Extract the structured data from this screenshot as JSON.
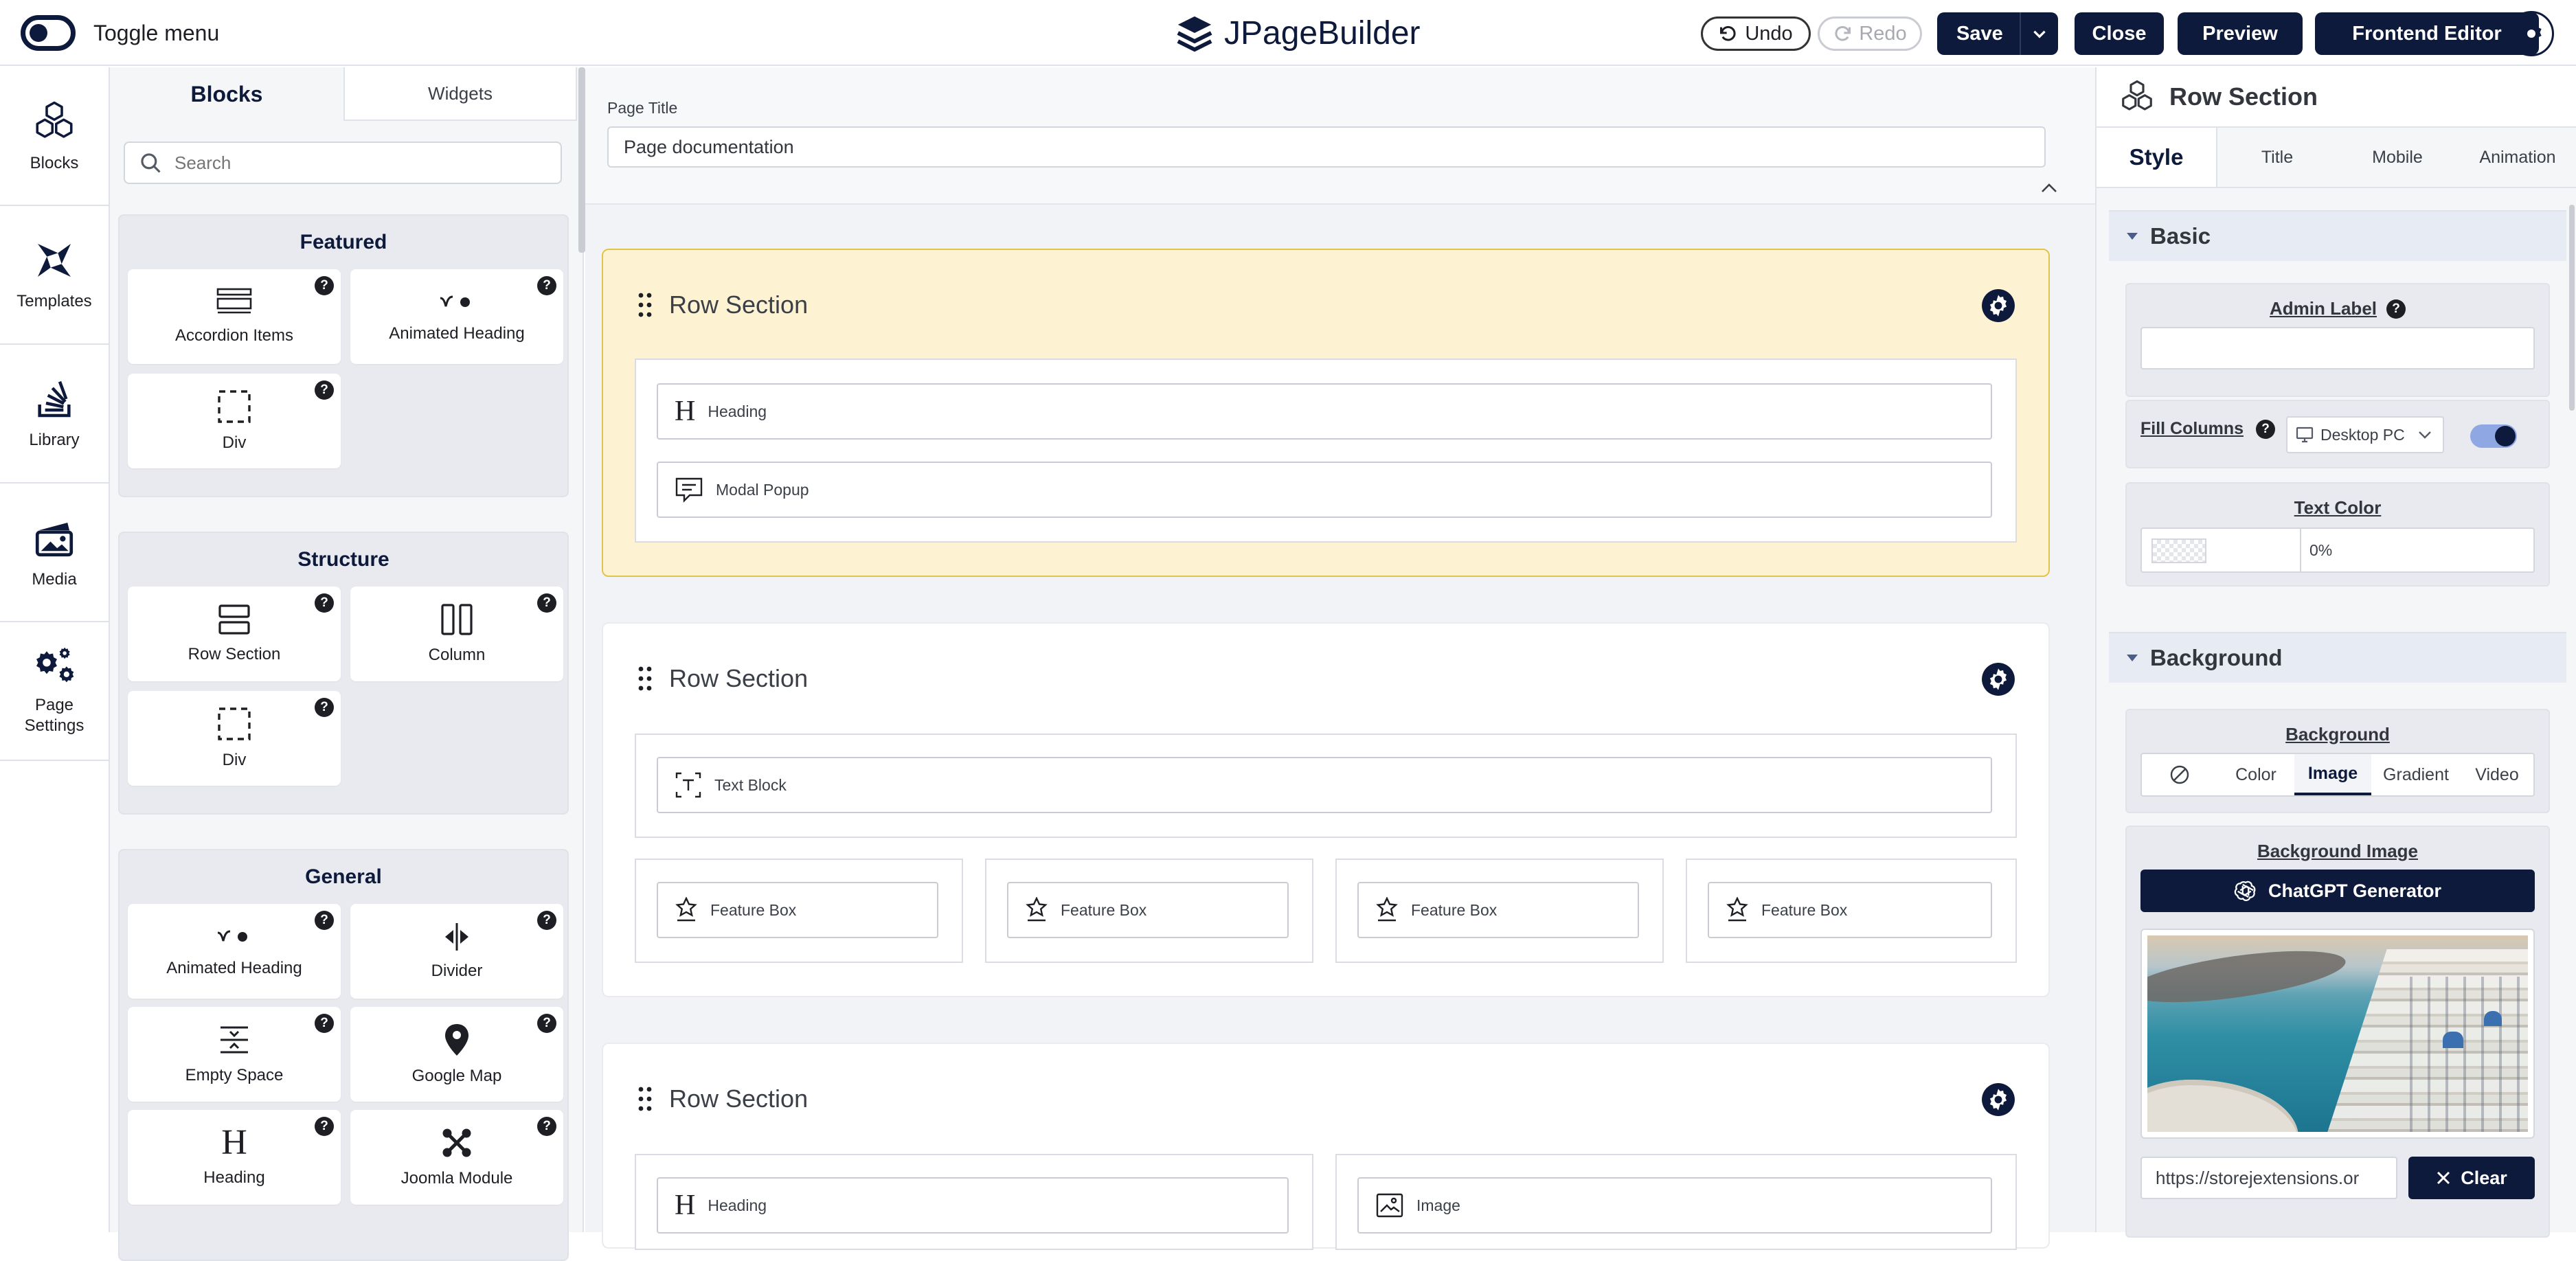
{
  "topbar": {
    "toggle_label": "Toggle menu",
    "brand": "JPageBuilder",
    "undo": "Undo",
    "redo": "Redo",
    "save": "Save",
    "close": "Close",
    "preview": "Preview",
    "frontend_editor": "Frontend Editor"
  },
  "rail": {
    "items": [
      {
        "label": "Blocks",
        "icon": "cubes-icon"
      },
      {
        "label": "Templates",
        "icon": "templates-icon"
      },
      {
        "label": "Library",
        "icon": "library-icon"
      },
      {
        "label": "Media",
        "icon": "media-icon"
      },
      {
        "label": "Page Settings",
        "icon": "gears-icon"
      }
    ]
  },
  "blocks_panel": {
    "tabs": [
      "Blocks",
      "Widgets"
    ],
    "search_placeholder": "Search",
    "groups": [
      {
        "title": "Featured",
        "items": [
          "Accordion Items",
          "Animated Heading",
          "Div"
        ]
      },
      {
        "title": "Structure",
        "items": [
          "Row Section",
          "Column",
          "Div"
        ]
      },
      {
        "title": "General",
        "items": [
          "Animated Heading",
          "Divider",
          "Empty Space",
          "Google Map",
          "Heading",
          "Joomla Module"
        ]
      }
    ]
  },
  "canvas": {
    "page_title_label": "Page Title",
    "page_title_value": "Page documentation",
    "sections": [
      {
        "title": "Row Section",
        "addons": [
          "Heading",
          "Modal Popup"
        ]
      },
      {
        "title": "Row Section",
        "addons": [
          "Text Block",
          "Feature Box",
          "Feature Box",
          "Feature Box",
          "Feature Box"
        ]
      },
      {
        "title": "Row Section",
        "addons": [
          "Heading",
          "Image"
        ]
      }
    ]
  },
  "right_panel": {
    "title": "Row Section",
    "tabs": [
      "Style",
      "Title",
      "Mobile",
      "Animation"
    ],
    "basic": {
      "header": "Basic",
      "admin_label": "Admin Label",
      "admin_label_value": "",
      "fill_columns": "Fill Columns",
      "device": "Desktop PC",
      "fill_columns_enabled": true,
      "text_color": "Text Color",
      "text_color_opacity": "0%"
    },
    "background": {
      "header": "Background",
      "label": "Background",
      "tabs": [
        "Color",
        "Image",
        "Gradient",
        "Video"
      ],
      "active_tab": "Image",
      "image_label": "Background Image",
      "chatgpt": "ChatGPT Generator",
      "url": "https://storejextensions.or",
      "clear": "Clear"
    }
  },
  "colors": {
    "primary": "#0e1a3c",
    "active_section_bg": "#fdf3d3",
    "active_section_border": "#e3c44a",
    "toggle_on": "#7f9be0"
  }
}
